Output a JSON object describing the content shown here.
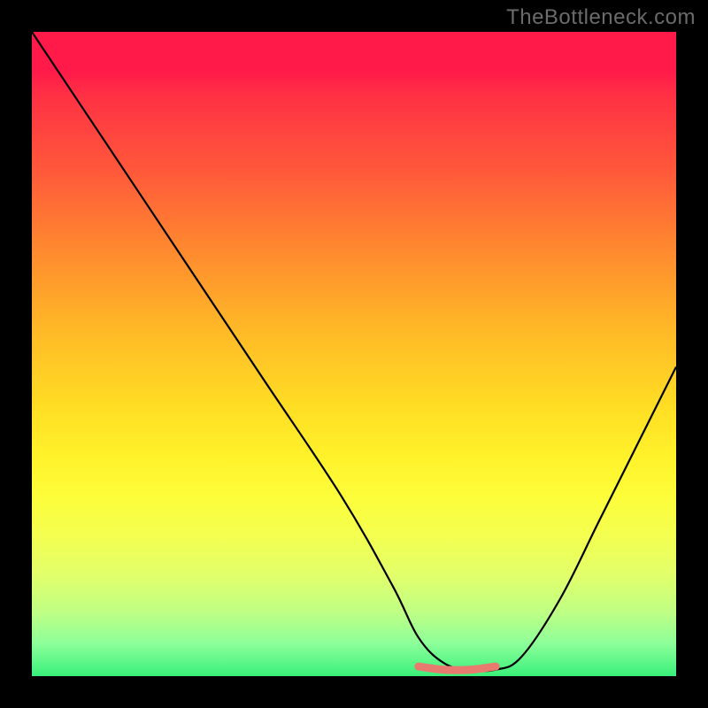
{
  "watermark": "TheBottleneck.com",
  "chart_data": {
    "type": "line",
    "title": "",
    "xlabel": "",
    "ylabel": "",
    "xlim": [
      0,
      100
    ],
    "ylim": [
      0,
      100
    ],
    "background_gradient": {
      "top": "#ff1a4a",
      "mid": "#fff22a",
      "bottom": "#39f07a"
    },
    "series": [
      {
        "name": "bottleneck-curve",
        "x": [
          0,
          12,
          24,
          36,
          48,
          56,
          60,
          64,
          68,
          72,
          76,
          82,
          88,
          94,
          100
        ],
        "values": [
          100,
          82,
          64,
          46,
          28,
          14,
          6,
          2,
          1,
          1,
          3,
          12,
          24,
          36,
          48
        ]
      },
      {
        "name": "optimal-marker",
        "x": [
          60,
          64,
          68,
          72
        ],
        "values": [
          1.5,
          1,
          1,
          1.5
        ]
      }
    ],
    "annotations": []
  }
}
